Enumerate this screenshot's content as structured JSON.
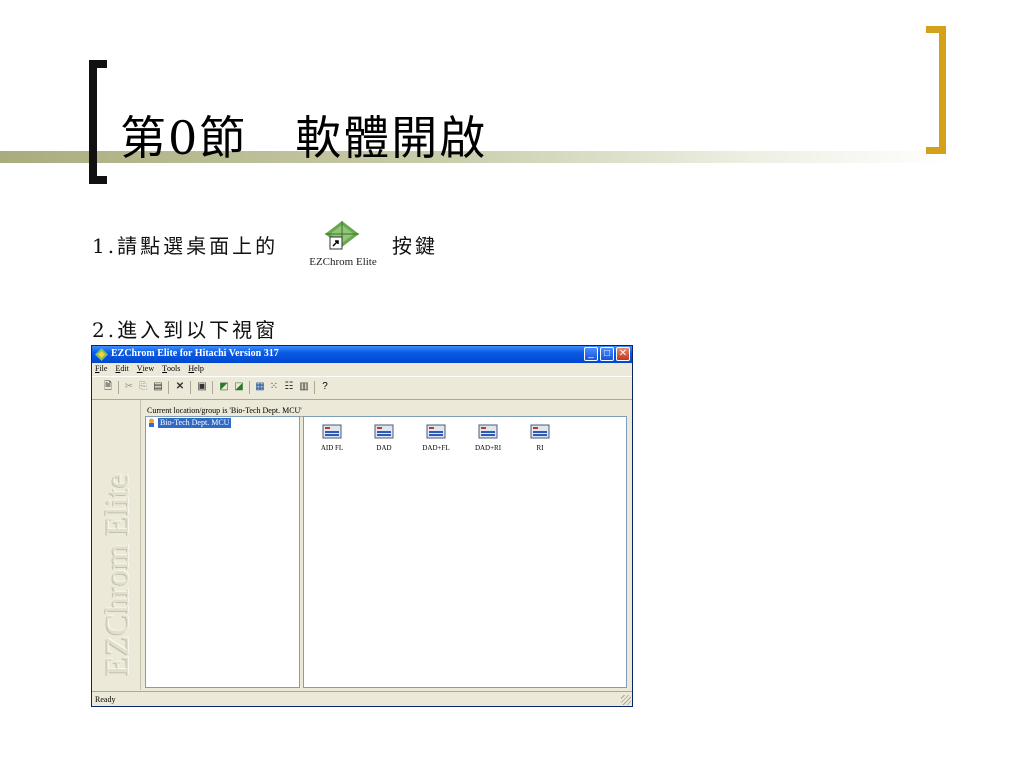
{
  "slide": {
    "title": "第0節　軟體開啟",
    "step1_text": "1.請點選桌面上的",
    "step1_tail": "按鍵",
    "step2_text": "2.進入到以下視窗",
    "desktop_icon_label": "EZChrom Elite"
  },
  "window": {
    "title": "EZChrom Elite for Hitachi Version 317",
    "menu": [
      {
        "accel": "F",
        "rest": "ile"
      },
      {
        "accel": "E",
        "rest": "dit"
      },
      {
        "accel": "V",
        "rest": "iew"
      },
      {
        "accel": "T",
        "rest": "ools"
      },
      {
        "accel": "H",
        "rest": "elp"
      }
    ],
    "sidebar_text": "EZChrom Elite",
    "location_text": "Current location/group is 'Bio-Tech Dept. MCU'",
    "tree_node": "Bio-Tech Dept. MCU",
    "instruments": [
      {
        "label": "AID FL"
      },
      {
        "label": "DAD"
      },
      {
        "label": "DAD+FL"
      },
      {
        "label": "DAD+RI"
      },
      {
        "label": "RI"
      }
    ],
    "status": "Ready"
  },
  "colors": {
    "title_bar": "#0a5ae6",
    "selection": "#316ac5",
    "right_bracket": "#d4a21a"
  },
  "icons": {
    "toolbar": [
      "new-icon",
      "cut-icon",
      "copy-icon",
      "paste-icon",
      "delete-icon",
      "properties-icon",
      "instrument-icon",
      "wizard-icon",
      "large-icons-icon",
      "small-icons-icon",
      "list-icon",
      "details-icon",
      "help-icon"
    ]
  }
}
